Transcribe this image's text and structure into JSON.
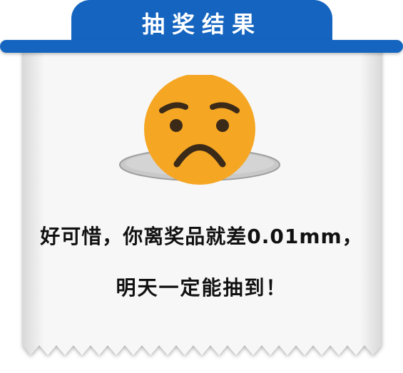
{
  "header": {
    "title": "抽奖结果"
  },
  "result": {
    "icon": "sad-face-icon",
    "message_line1": "好可惜，你离奖品就差0.01mm，",
    "message_line2": "明天一定能抽到！"
  },
  "colors": {
    "header_blue": "#1565c0",
    "face_orange": "#f5a623",
    "paper": "#f4f4f4"
  }
}
